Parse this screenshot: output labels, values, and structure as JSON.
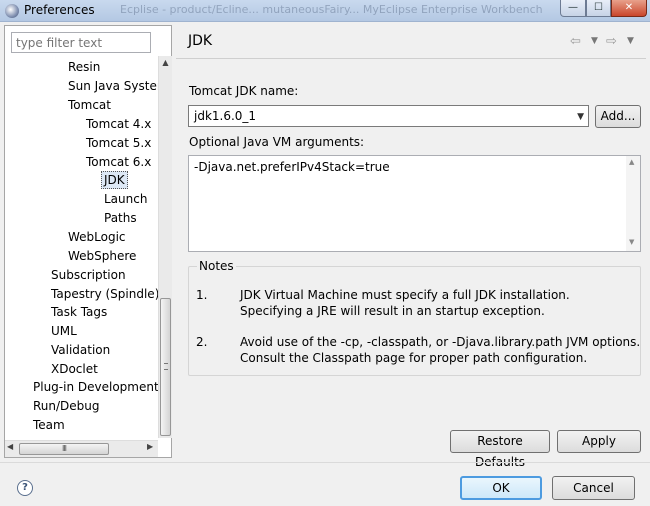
{
  "window": {
    "title": "Preferences",
    "background_title": "Ecplise - product/Ecline... mutaneousFairy... MyEclipse Enterprise Workbench",
    "controls": {
      "minimize": "—",
      "maximize": "☐",
      "close": "✕"
    }
  },
  "sidebar": {
    "filter_placeholder": "type filter text",
    "items": [
      {
        "label": "Resin"
      },
      {
        "label": "Sun Java System"
      },
      {
        "label": "Tomcat"
      },
      {
        "label": "Tomcat  4.x"
      },
      {
        "label": "Tomcat  5.x"
      },
      {
        "label": "Tomcat  6.x"
      },
      {
        "label": "JDK",
        "selected": true
      },
      {
        "label": "Launch"
      },
      {
        "label": "Paths"
      },
      {
        "label": "WebLogic"
      },
      {
        "label": "WebSphere"
      },
      {
        "label": "Subscription"
      },
      {
        "label": "Tapestry (Spindle)"
      },
      {
        "label": "Task Tags"
      },
      {
        "label": "UML"
      },
      {
        "label": "Validation"
      },
      {
        "label": "XDoclet"
      },
      {
        "label": "Plug-in Development"
      },
      {
        "label": "Run/Debug"
      },
      {
        "label": "Team"
      }
    ],
    "hscroll_grip": "III"
  },
  "page": {
    "title": "JDK",
    "jdk_name_label": "Tomcat JDK name:",
    "jdk_selected": "jdk1.6.0_1",
    "add_label": "Add...",
    "vm_args_label": "Optional Java VM arguments:",
    "vm_args_value": "-Djava.net.preferIPv4Stack=true",
    "notes": {
      "title": "Notes",
      "items": [
        {
          "num": "1.",
          "lines": [
            "JDK Virtual Machine must specify a full JDK installation.",
            "Specifying a JRE will result in an startup exception."
          ]
        },
        {
          "num": "2.",
          "lines": [
            "Avoid use of the -cp, -classpath, or -Djava.library.path JVM options.",
            "Consult the Classpath page for proper path configuration."
          ]
        }
      ]
    },
    "restore_defaults_label": "Restore Defaults",
    "apply_label": "Apply"
  },
  "footer": {
    "help": "?",
    "ok_label": "OK",
    "cancel_label": "Cancel"
  }
}
